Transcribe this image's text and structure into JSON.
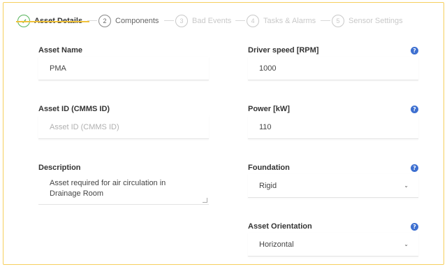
{
  "steps": [
    {
      "number": "✓",
      "label": "Asset Details",
      "state": "active"
    },
    {
      "number": "2",
      "label": "Components",
      "state": "next"
    },
    {
      "number": "3",
      "label": "Bad Events",
      "state": "muted"
    },
    {
      "number": "4",
      "label": "Tasks & Alarms",
      "state": "muted"
    },
    {
      "number": "5",
      "label": "Sensor Settings",
      "state": "muted"
    }
  ],
  "left": {
    "asset_name": {
      "label": "Asset Name",
      "value": "PMA"
    },
    "asset_id": {
      "label": "Asset ID (CMMS ID)",
      "placeholder": "Asset ID (CMMS ID)"
    },
    "description": {
      "label": "Description",
      "value": "Asset required for air circulation in Drainage Room"
    }
  },
  "right": {
    "driver_speed": {
      "label": "Driver speed [RPM]",
      "value": "1000"
    },
    "power": {
      "label": "Power [kW]",
      "value": "110"
    },
    "foundation": {
      "label": "Foundation",
      "value": "Rigid"
    },
    "orientation": {
      "label": "Asset Orientation",
      "value": "Horizontal"
    }
  },
  "help_glyph": "?",
  "caret_glyph": "⌄",
  "colors": {
    "accent": "#f0c23b",
    "success": "#57b45c",
    "help": "#3d6fd0",
    "frame": "#f6cf5e"
  }
}
